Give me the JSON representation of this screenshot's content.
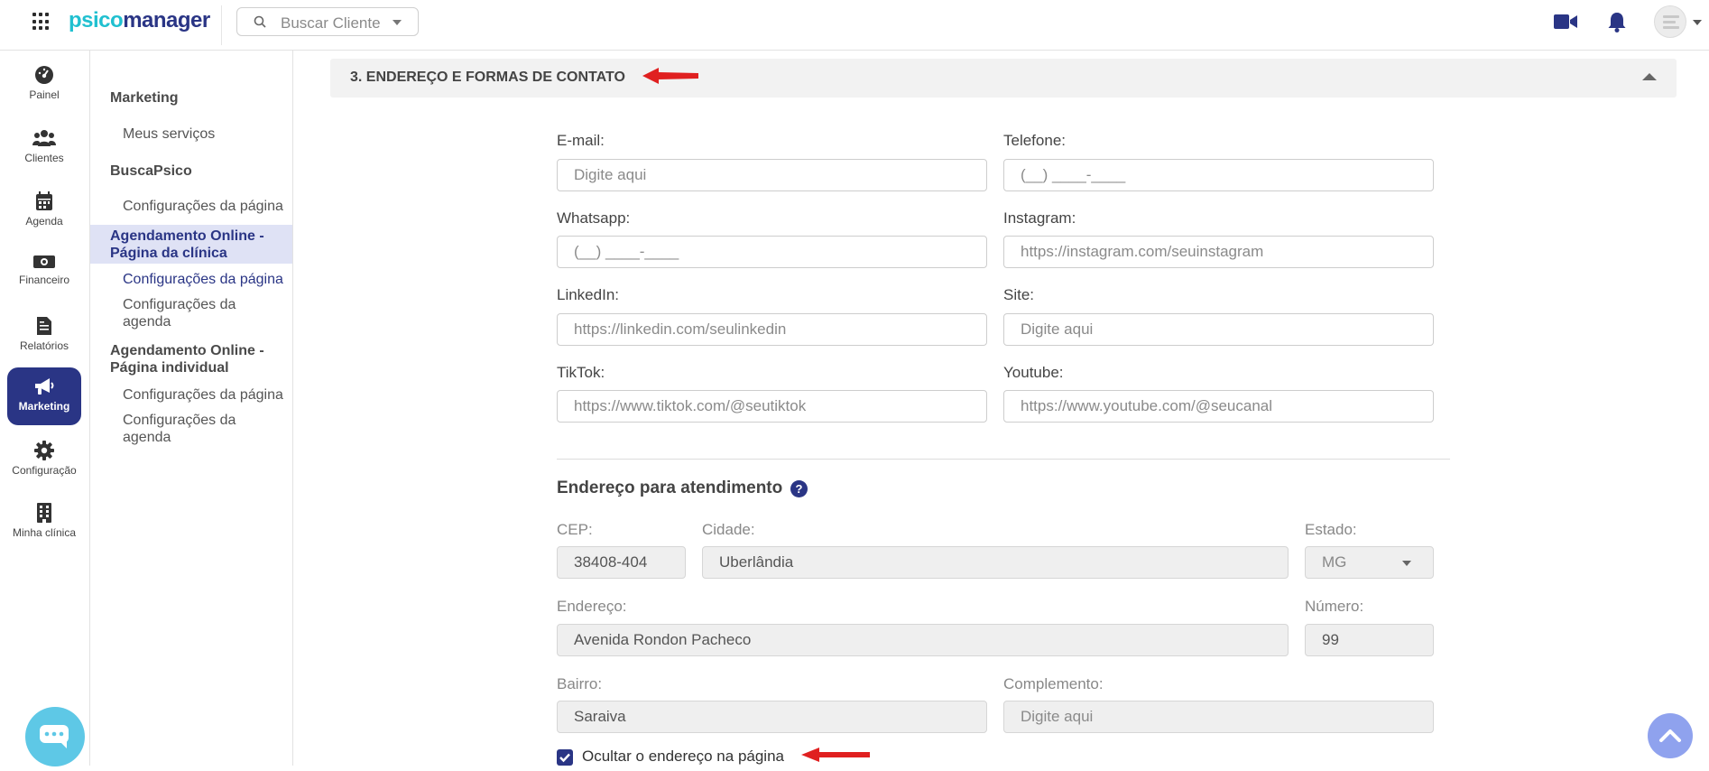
{
  "app": {
    "logo_part1": "psico",
    "logo_part2": "manager"
  },
  "topbar": {
    "search_placeholder": "Buscar Cliente",
    "icons": [
      "apps-grid-icon",
      "search-icon",
      "video-camera-icon",
      "bell-icon",
      "avatar"
    ]
  },
  "leftnav": {
    "items": [
      {
        "label": "Painel",
        "icon": "dashboard-icon"
      },
      {
        "label": "Clientes",
        "icon": "users-icon"
      },
      {
        "label": "Agenda",
        "icon": "calendar-icon"
      },
      {
        "label": "Financeiro",
        "icon": "money-icon"
      },
      {
        "label": "Relatórios",
        "icon": "report-icon"
      },
      {
        "label": "Marketing",
        "icon": "megaphone-icon",
        "active": true
      },
      {
        "label": "Configuração",
        "icon": "gear-icon"
      },
      {
        "label": "Minha clínica",
        "icon": "building-icon"
      }
    ]
  },
  "subnav": {
    "marketing": "Marketing",
    "meus_servicos": "Meus serviços",
    "buscapsico": "BuscaPsico",
    "buscapsico_config": "Configurações da página",
    "ag_clinica_l1": "Agendamento Online -",
    "ag_clinica_l2": "Página da clínica",
    "ag_clinica_config_pagina": "Configurações da página",
    "ag_clinica_config_agenda_l1": "Configurações da",
    "ag_clinica_config_agenda_l2": "agenda",
    "ag_individual_l1": "Agendamento Online -",
    "ag_individual_l2": "Página individual",
    "ag_individual_config_pagina": "Configurações da página",
    "ag_individual_config_agenda_l1": "Configurações da",
    "ag_individual_config_agenda_l2": "agenda"
  },
  "section": {
    "title": "3. ENDEREÇO E FORMAS DE CONTATO"
  },
  "contact": {
    "email_label": "E-mail:",
    "email_placeholder": "Digite aqui",
    "telefone_label": "Telefone:",
    "telefone_placeholder": "(__) ____-____",
    "whatsapp_label": "Whatsapp:",
    "whatsapp_placeholder": "(__) ____-____",
    "instagram_label": "Instagram:",
    "instagram_placeholder": "https://instagram.com/seuinstagram",
    "linkedin_label": "LinkedIn:",
    "linkedin_placeholder": "https://linkedin.com/seulinkedin",
    "site_label": "Site:",
    "site_placeholder": "Digite aqui",
    "tiktok_label": "TikTok:",
    "tiktok_placeholder": "https://www.tiktok.com/@seutiktok",
    "youtube_label": "Youtube:",
    "youtube_placeholder": "https://www.youtube.com/@seucanal"
  },
  "address": {
    "title": "Endereço para atendimento",
    "help": "?",
    "cep_label": "CEP:",
    "cep_value": "38408-404",
    "cidade_label": "Cidade:",
    "cidade_value": "Uberlândia",
    "estado_label": "Estado:",
    "estado_value": "MG",
    "endereco_label": "Endereço:",
    "endereco_value": "Avenida Rondon Pacheco",
    "numero_label": "Número:",
    "numero_value": "99",
    "bairro_label": "Bairro:",
    "bairro_value": "Saraiva",
    "complemento_label": "Complemento:",
    "complemento_placeholder": "Digite aqui",
    "hide_checkbox_label": "Ocultar o endereço na página",
    "hide_checkbox_checked": true
  },
  "colors": {
    "brand_dark": "#2a3585",
    "brand_light": "#20c0d0",
    "annotation_arrow": "#e02020",
    "active_bg": "#dfe2f5"
  }
}
